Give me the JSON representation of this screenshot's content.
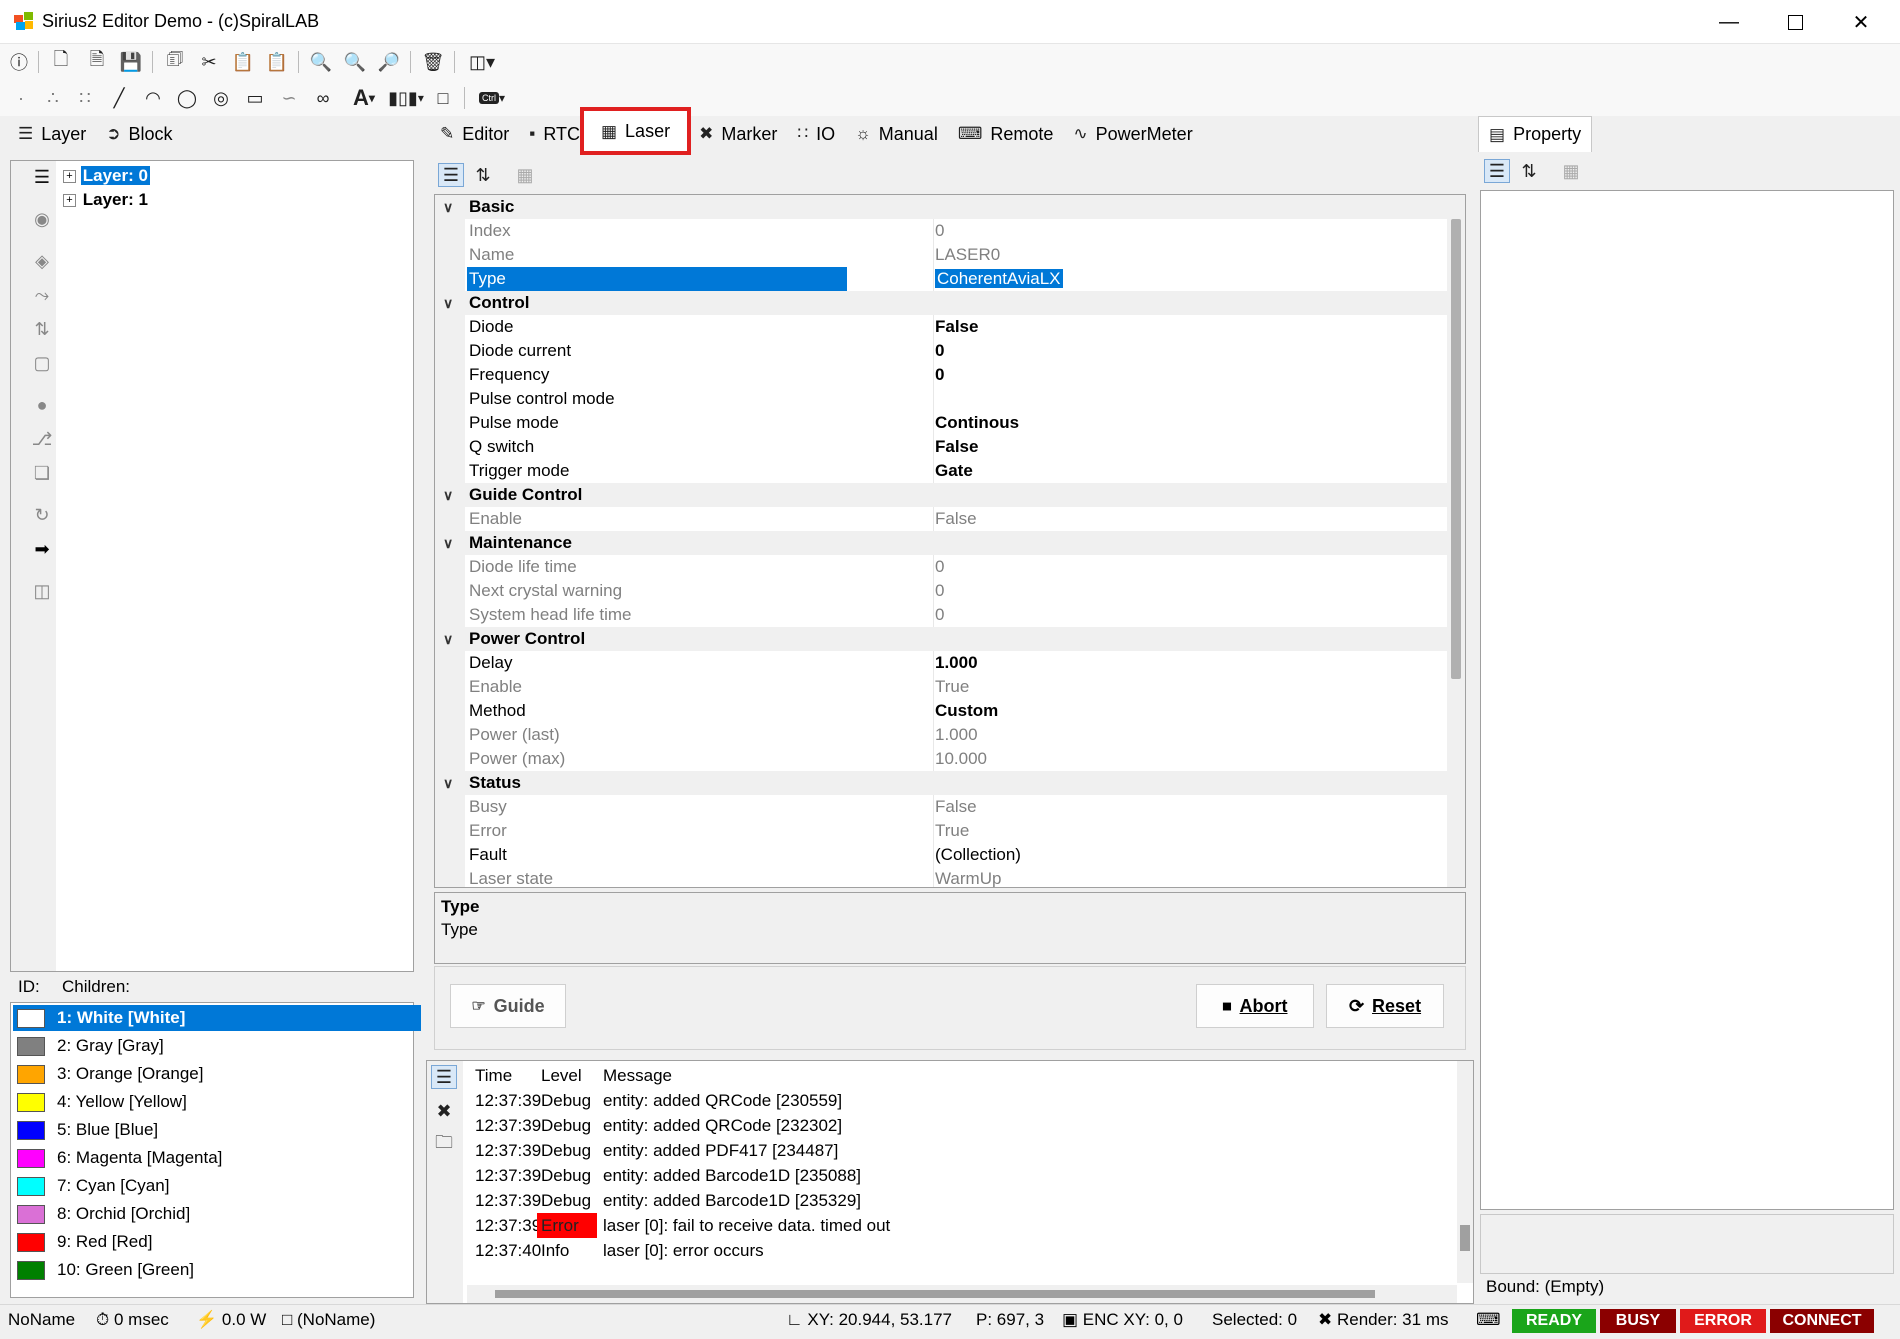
{
  "window": {
    "title": "Sirius2 Editor Demo - (c)SpiralLAB"
  },
  "left_tabs": [
    {
      "label": "Layer"
    },
    {
      "label": "Block"
    }
  ],
  "tree": [
    {
      "label": "Layer: 0"
    },
    {
      "label": "Layer: 1"
    }
  ],
  "left_info": {
    "id_label": "ID:",
    "children_label": "Children:"
  },
  "colors": [
    {
      "label": "1: White [White]",
      "hex": "#ffffff"
    },
    {
      "label": "2: Gray [Gray]",
      "hex": "#808080"
    },
    {
      "label": "3: Orange [Orange]",
      "hex": "#ffa500"
    },
    {
      "label": "4: Yellow [Yellow]",
      "hex": "#ffff00"
    },
    {
      "label": "5: Blue [Blue]",
      "hex": "#0000ff"
    },
    {
      "label": "6: Magenta [Magenta]",
      "hex": "#ff00ff"
    },
    {
      "label": "7: Cyan [Cyan]",
      "hex": "#00ffff"
    },
    {
      "label": "8: Orchid [Orchid]",
      "hex": "#da70d6"
    },
    {
      "label": "9: Red [Red]",
      "hex": "#ff0000"
    },
    {
      "label": "10: Green [Green]",
      "hex": "#008000"
    }
  ],
  "center_tabs": [
    {
      "label": "Editor"
    },
    {
      "label": "RTC"
    },
    {
      "label": "Laser"
    },
    {
      "label": "Marker"
    },
    {
      "label": "IO"
    },
    {
      "label": "Manual"
    },
    {
      "label": "Remote"
    },
    {
      "label": "PowerMeter"
    }
  ],
  "property_grid": {
    "categories": [
      {
        "name": "Basic",
        "rows": [
          {
            "name": "Index",
            "value": "0",
            "style": "gray"
          },
          {
            "name": "Name",
            "value": "LASER0",
            "style": "gray"
          },
          {
            "name": "Type",
            "value": "CoherentAviaLX",
            "style": "selected"
          }
        ]
      },
      {
        "name": "Control",
        "rows": [
          {
            "name": "Diode",
            "value": "False",
            "style": "bold"
          },
          {
            "name": "Diode current",
            "value": "0",
            "style": "bold"
          },
          {
            "name": "Frequency",
            "value": "0",
            "style": "bold"
          },
          {
            "name": "Pulse control mode",
            "value": "",
            "style": "bold"
          },
          {
            "name": "Pulse mode",
            "value": "Continous",
            "style": "bold"
          },
          {
            "name": "Q switch",
            "value": "False",
            "style": "bold"
          },
          {
            "name": "Trigger mode",
            "value": "Gate",
            "style": "bold"
          }
        ]
      },
      {
        "name": "Guide Control",
        "rows": [
          {
            "name": "Enable",
            "value": "False",
            "style": "gray"
          }
        ]
      },
      {
        "name": "Maintenance",
        "rows": [
          {
            "name": "Diode life time",
            "value": "0",
            "style": "gray"
          },
          {
            "name": "Next crystal warning",
            "value": "0",
            "style": "gray"
          },
          {
            "name": "System head life time",
            "value": "0",
            "style": "gray"
          }
        ]
      },
      {
        "name": "Power Control",
        "rows": [
          {
            "name": "Delay",
            "value": "1.000",
            "style": "bold"
          },
          {
            "name": "Enable",
            "value": "True",
            "style": "gray"
          },
          {
            "name": "Method",
            "value": "Custom",
            "style": "bold"
          },
          {
            "name": "Power (last)",
            "value": "1.000",
            "style": "gray"
          },
          {
            "name": "Power (max)",
            "value": "10.000",
            "style": "gray"
          }
        ]
      },
      {
        "name": "Status",
        "rows": [
          {
            "name": "Busy",
            "value": "False",
            "style": "gray"
          },
          {
            "name": "Error",
            "value": "True",
            "style": "gray"
          },
          {
            "name": "Fault",
            "value": "(Collection)",
            "style": "normal"
          },
          {
            "name": "Laser state",
            "value": "WarmUp",
            "style": "gray"
          }
        ]
      }
    ]
  },
  "description": {
    "title": "Type",
    "text": "Type"
  },
  "buttons": {
    "guide": "Guide",
    "abort": "Abort",
    "reset": "Reset"
  },
  "log": {
    "headers": {
      "time": "Time",
      "level": "Level",
      "message": "Message"
    },
    "rows": [
      {
        "time": "12:37:39",
        "level": "Debug",
        "message": "entity: added QRCode [230559]"
      },
      {
        "time": "12:37:39",
        "level": "Debug",
        "message": "entity: added QRCode [232302]"
      },
      {
        "time": "12:37:39",
        "level": "Debug",
        "message": "entity: added PDF417 [234487]"
      },
      {
        "time": "12:37:39",
        "level": "Debug",
        "message": "entity: added Barcode1D [235088]"
      },
      {
        "time": "12:37:39",
        "level": "Debug",
        "message": "entity: added Barcode1D [235329]"
      },
      {
        "time": "12:37:39",
        "level": "Error",
        "message": "laser [0]: fail to receive data. timed out"
      },
      {
        "time": "12:37:40",
        "level": "Info",
        "message": "laser [0]: error occurs"
      }
    ]
  },
  "right_panel": {
    "tab": "Property",
    "bound": "Bound: (Empty)"
  },
  "status_bar": {
    "name": "NoName",
    "time": "0 msec",
    "power": "0.0 W",
    "doc": "(NoName)",
    "xy": "XY: 20.944, 53.177",
    "p": "P: 697, 3",
    "enc": "ENC XY: 0, 0",
    "selected": "Selected: 0",
    "render": "Render: 31 ms",
    "badges": [
      {
        "label": "READY",
        "color": "#1aa51a"
      },
      {
        "label": "BUSY",
        "color": "#8b0000"
      },
      {
        "label": "ERROR",
        "color": "#e01a1a"
      },
      {
        "label": "CONNECT",
        "color": "#8b0000"
      }
    ]
  }
}
